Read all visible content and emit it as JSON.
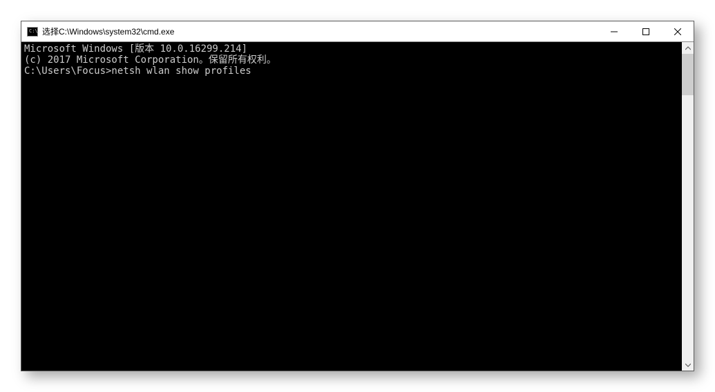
{
  "window": {
    "title": "选择C:\\Windows\\system32\\cmd.exe",
    "icon_text": "C:\\."
  },
  "terminal": {
    "lines": [
      "Microsoft Windows [版本 10.0.16299.214]",
      "(c) 2017 Microsoft Corporation。保留所有权利。",
      "",
      "C:\\Users\\Focus>netsh wlan show profiles"
    ]
  }
}
